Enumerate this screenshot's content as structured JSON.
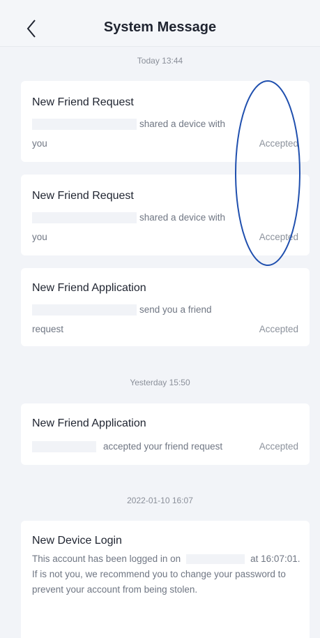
{
  "header": {
    "title": "System Message",
    "back_icon": "chevron-left-icon"
  },
  "groups": [
    {
      "timestamp": "Today 13:44",
      "messages": [
        {
          "title": "New Friend Request",
          "line1": "shared a device with",
          "line2": "you",
          "status": "Accepted"
        },
        {
          "title": "New Friend Request",
          "line1": "shared a device with",
          "line2": "you",
          "status": "Accepted"
        },
        {
          "title": "New Friend Application",
          "line1": "send you a friend",
          "line2": "request",
          "status": "Accepted"
        }
      ]
    },
    {
      "timestamp": "Yesterday 15:50",
      "messages": [
        {
          "title": "New Friend Application",
          "line1": "accepted your friend request",
          "status": "Accepted"
        }
      ]
    },
    {
      "timestamp": "2022-01-10 16:07",
      "messages": [
        {
          "title": "New Device Login",
          "body_part1": "This account has been logged in on",
          "body_part2": "at 16:07:01. If is not you, we recommend you to change your password to prevent your account from being stolen."
        }
      ]
    }
  ],
  "annotation_color": "#1f4fae"
}
